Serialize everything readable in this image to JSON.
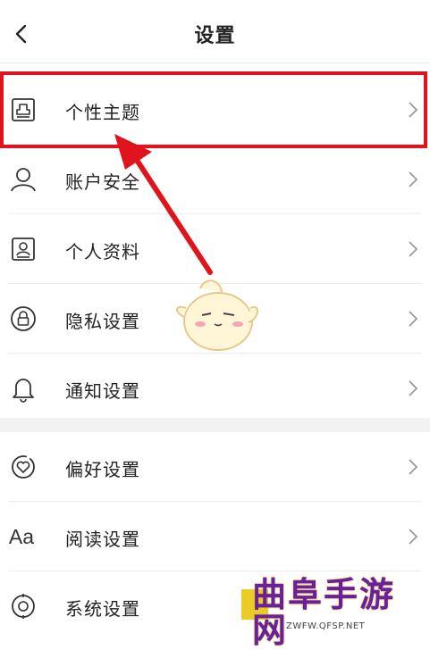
{
  "header": {
    "title": "设置"
  },
  "groups": [
    {
      "items": [
        {
          "label": "个性主题",
          "icon": "theme-icon"
        },
        {
          "label": "账户安全",
          "icon": "user-icon"
        },
        {
          "label": "个人资料",
          "icon": "profile-card-icon"
        },
        {
          "label": "隐私设置",
          "icon": "lock-icon"
        },
        {
          "label": "通知设置",
          "icon": "bell-icon"
        }
      ]
    },
    {
      "items": [
        {
          "label": "偏好设置",
          "icon": "heart-badge-icon"
        },
        {
          "label": "阅读设置",
          "icon": "font-aa-icon",
          "icon_text": "Aa"
        },
        {
          "label": "系统设置",
          "icon": "system-gear-icon"
        }
      ]
    }
  ],
  "annotation": {
    "highlight_color": "#e0141c"
  },
  "watermark": {
    "text": "曲阜手游网",
    "url": "ZWFW.QFSP.NET"
  }
}
